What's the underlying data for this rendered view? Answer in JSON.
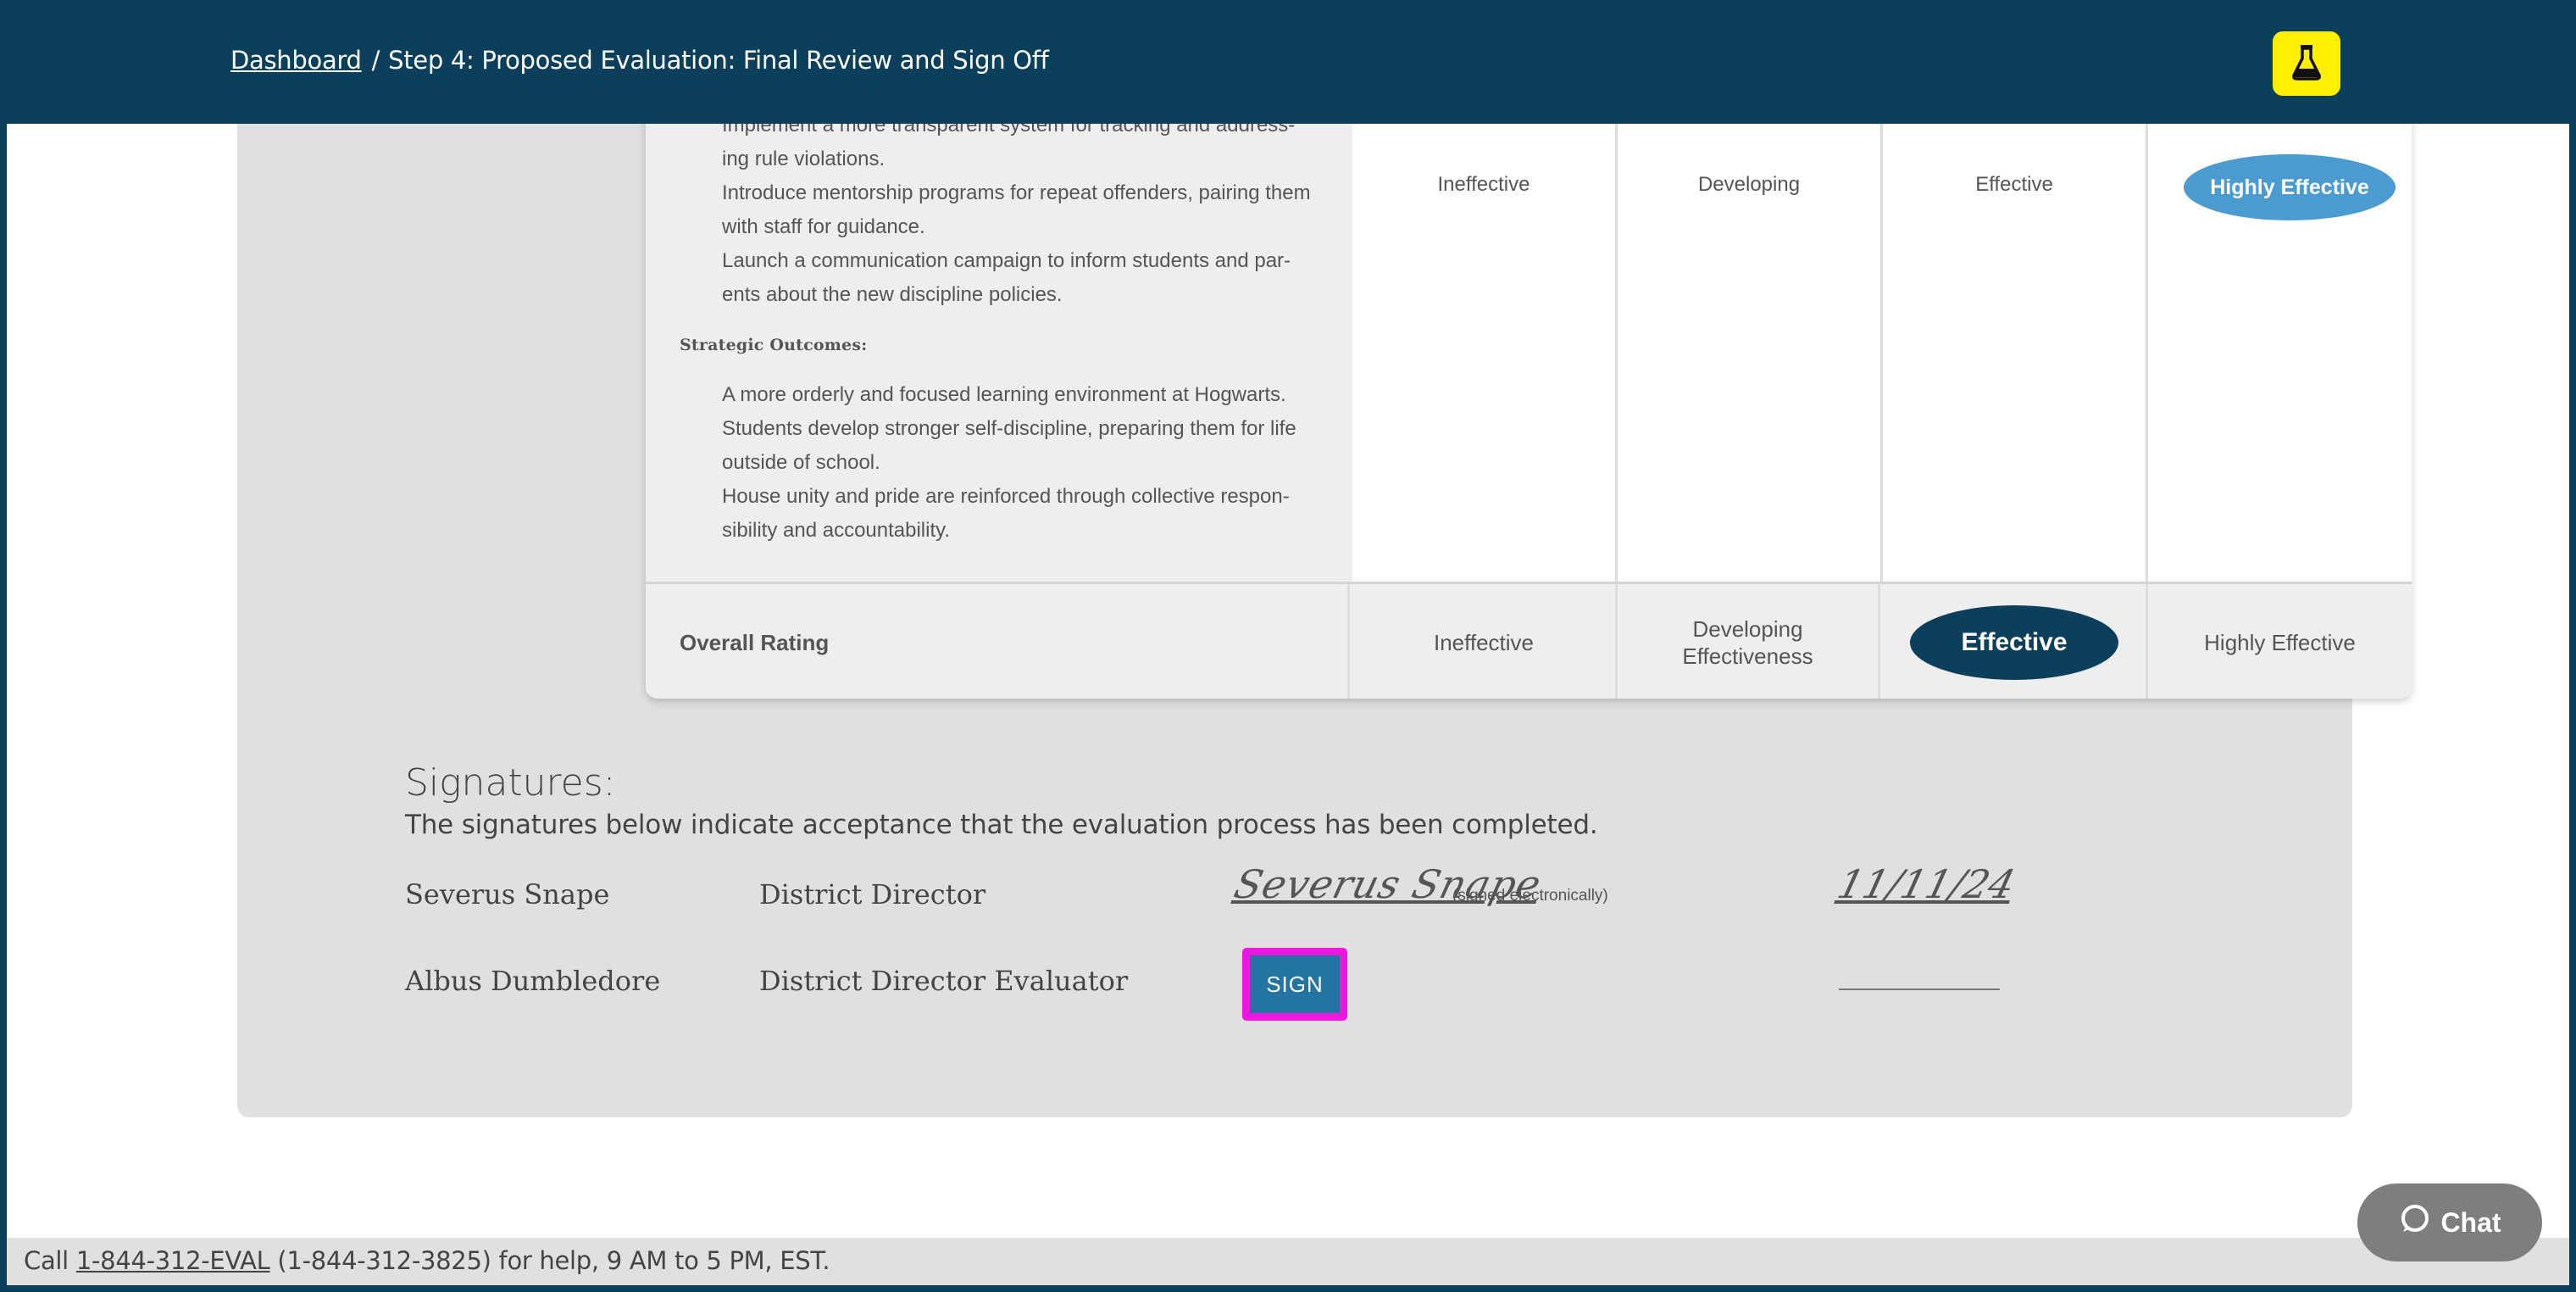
{
  "header": {
    "breadcrumb_link": "Dashboard",
    "separator": "/",
    "current_page": "Step 4: Proposed Evaluation: Final Review and Sign Off",
    "lab_icon": "flask-icon",
    "accent_color": "#ffef00",
    "bg_color": "#0b3f5c"
  },
  "rubric": {
    "bullets_top": [
      "Implement a more transparent system for tracking and address-ing rule violations.",
      "Introduce mentorship programs for repeat offenders, pairing them with staff for guidance.",
      "Launch a communication campaign to inform students and par-ents about the new discipline policies."
    ],
    "outcomes_heading": "Strategic Outcomes:",
    "outcomes": [
      "A more orderly and focused learning environment at Hogwarts.",
      "Students develop stronger self-discipline, preparing them for life outside of school.",
      "House unity and pride are reinforced through collective respon-sibility and accountability."
    ],
    "ratings": [
      "Ineffective",
      "Developing",
      "Effective",
      "Highly Effective"
    ],
    "selected_rating": "Highly Effective"
  },
  "overall": {
    "label": "Overall Rating",
    "options": [
      "Ineffective",
      "Developing Effectiveness",
      "Effective",
      "Highly Effective"
    ],
    "selected": "Effective"
  },
  "signatures": {
    "title": "Signatures:",
    "subtitle": "The signatures below indicate acceptance that the evaluation process has been completed.",
    "rows": [
      {
        "name": "Severus Snape",
        "role": "District Director",
        "signature": "Severus Snape",
        "note": "(signed electronically)",
        "date": "11/11/24"
      },
      {
        "name": "Albus Dumbledore",
        "role": "District Director Evaluator",
        "button": "SIGN"
      }
    ]
  },
  "footer": {
    "prefix": "Call ",
    "phone_link": "1-844-312-EVAL",
    "rest": " (1-844-312-3825) for help, 9 AM to 5 PM, EST."
  },
  "chat": {
    "label": "Chat",
    "icon": "chat-bubble-icon"
  }
}
